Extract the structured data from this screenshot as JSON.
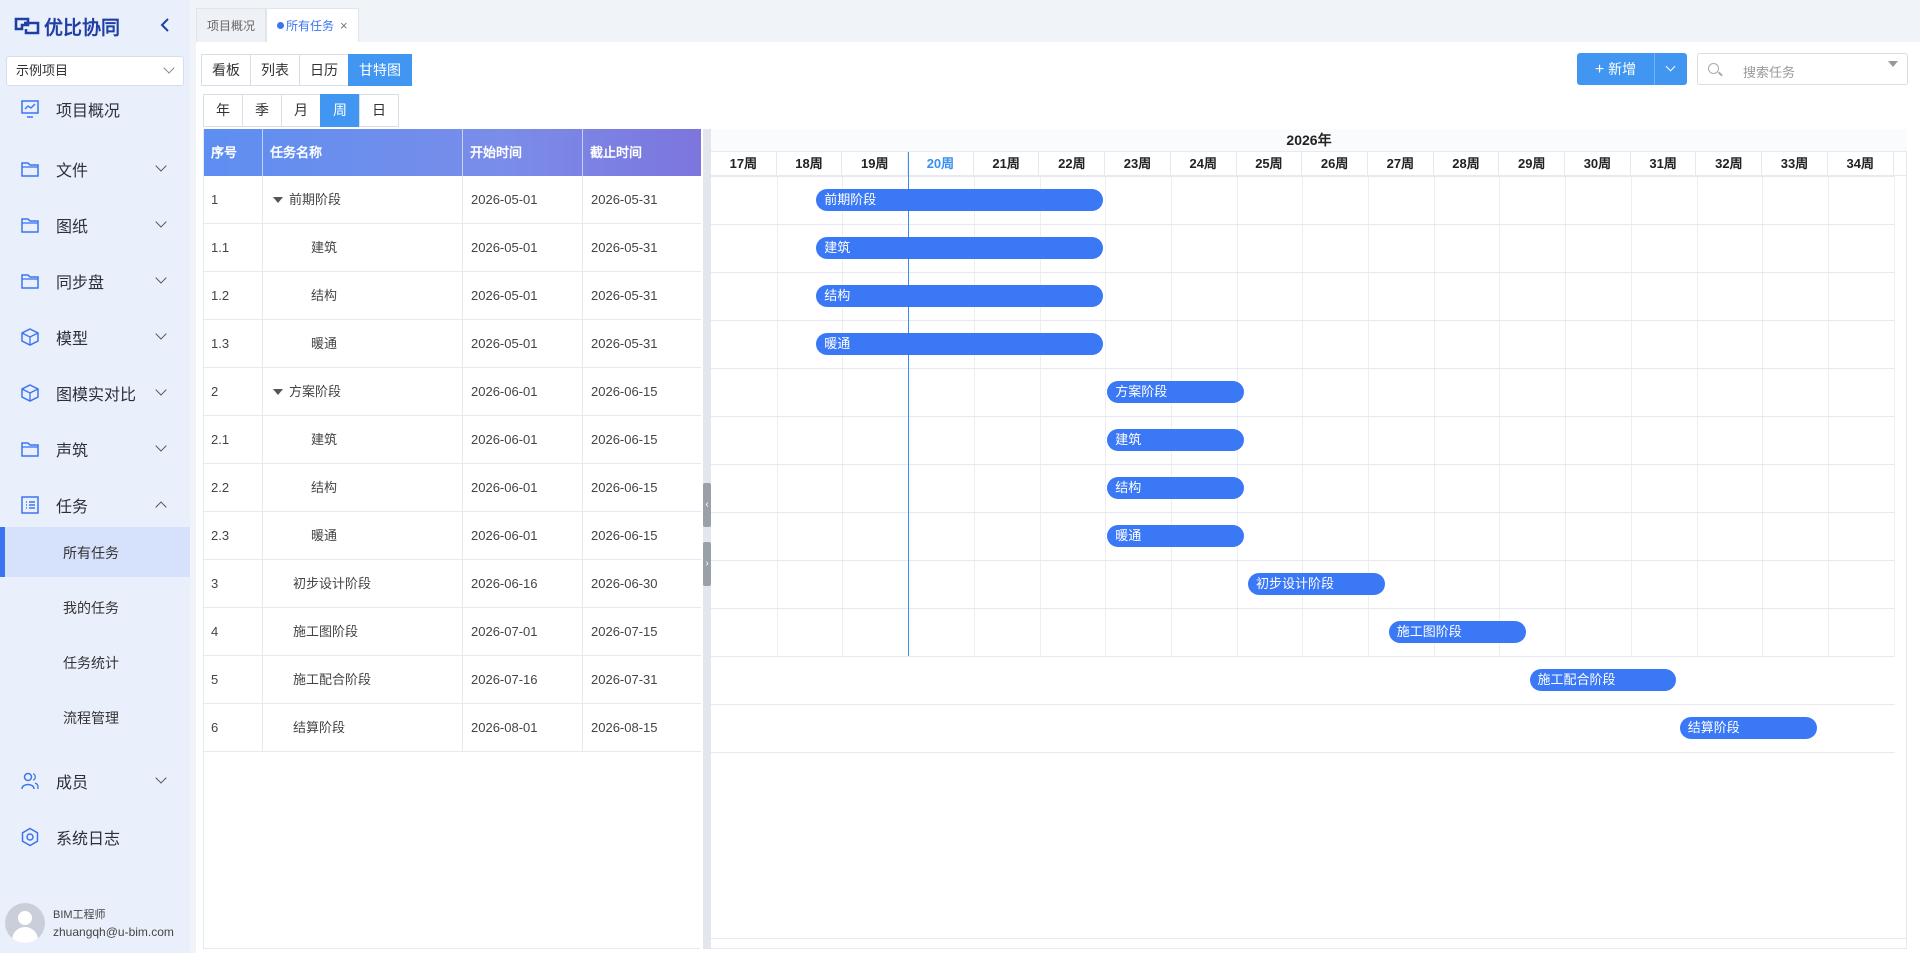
{
  "app": {
    "logo_text": "优比协同",
    "project": "示例项目"
  },
  "sidebar": {
    "items": [
      {
        "label": "项目概况",
        "icon": "monitor-icon",
        "has_chevron": false
      },
      {
        "label": "文件",
        "icon": "folder-icon",
        "has_chevron": true
      },
      {
        "label": "图纸",
        "icon": "folder-icon",
        "has_chevron": true
      },
      {
        "label": "同步盘",
        "icon": "folder-icon",
        "has_chevron": true
      },
      {
        "label": "模型",
        "icon": "cube-icon",
        "has_chevron": true
      },
      {
        "label": "图模实对比",
        "icon": "cube-icon",
        "has_chevron": true
      },
      {
        "label": "声筑",
        "icon": "folder-icon",
        "has_chevron": true
      },
      {
        "label": "任务",
        "icon": "task-list-icon",
        "has_chevron": true,
        "expanded": true
      },
      {
        "label": "成员",
        "icon": "users-icon",
        "has_chevron": true
      },
      {
        "label": "系统日志",
        "icon": "hexagon-gear-icon",
        "has_chevron": false
      }
    ],
    "task_sub": [
      {
        "label": "所有任务",
        "active": true
      },
      {
        "label": "我的任务",
        "active": false
      },
      {
        "label": "任务统计",
        "active": false
      },
      {
        "label": "流程管理",
        "active": false
      }
    ],
    "user": {
      "role": "BIM工程师",
      "email": "zhuangqh@u-bim.com"
    }
  },
  "tabs": [
    {
      "label": "项目概况",
      "active": false
    },
    {
      "label": "所有任务",
      "active": true,
      "close": "×"
    }
  ],
  "toolbar": {
    "views": [
      "看板",
      "列表",
      "日历",
      "甘特图"
    ],
    "active_view": "甘特图",
    "scales": [
      "年",
      "季",
      "月",
      "周",
      "日"
    ],
    "active_scale": "周",
    "add_label": "新增",
    "add_icon": "+",
    "search_placeholder": "搜索任务"
  },
  "grid": {
    "columns": [
      "序号",
      "任务名称",
      "开始时间",
      "截止时间"
    ],
    "rows": [
      {
        "id": "1",
        "name": "前期阶段",
        "start": "2026-05-01",
        "end": "2026-05-31",
        "level": 0,
        "expandable": true
      },
      {
        "id": "1.1",
        "name": "建筑",
        "start": "2026-05-01",
        "end": "2026-05-31",
        "level": 1,
        "expandable": false
      },
      {
        "id": "1.2",
        "name": "结构",
        "start": "2026-05-01",
        "end": "2026-05-31",
        "level": 1,
        "expandable": false
      },
      {
        "id": "1.3",
        "name": "暖通",
        "start": "2026-05-01",
        "end": "2026-05-31",
        "level": 1,
        "expandable": false
      },
      {
        "id": "2",
        "name": "方案阶段",
        "start": "2026-06-01",
        "end": "2026-06-15",
        "level": 0,
        "expandable": true
      },
      {
        "id": "2.1",
        "name": "建筑",
        "start": "2026-06-01",
        "end": "2026-06-15",
        "level": 1,
        "expandable": false
      },
      {
        "id": "2.2",
        "name": "结构",
        "start": "2026-06-01",
        "end": "2026-06-15",
        "level": 1,
        "expandable": false
      },
      {
        "id": "2.3",
        "name": "暖通",
        "start": "2026-06-01",
        "end": "2026-06-15",
        "level": 1,
        "expandable": false
      },
      {
        "id": "3",
        "name": "初步设计阶段",
        "start": "2026-06-16",
        "end": "2026-06-30",
        "level": 0,
        "expandable": false
      },
      {
        "id": "4",
        "name": "施工图阶段",
        "start": "2026-07-01",
        "end": "2026-07-15",
        "level": 0,
        "expandable": false
      },
      {
        "id": "5",
        "name": "施工配合阶段",
        "start": "2026-07-16",
        "end": "2026-07-31",
        "level": 0,
        "expandable": false
      },
      {
        "id": "6",
        "name": "结算阶段",
        "start": "2026-08-01",
        "end": "2026-08-15",
        "level": 0,
        "expandable": false
      }
    ]
  },
  "gantt": {
    "year": "2026年",
    "weeks": [
      "17周",
      "18周",
      "19周",
      "20周",
      "21周",
      "22周",
      "23周",
      "24周",
      "25周",
      "26周",
      "27周",
      "28周",
      "29周",
      "30周",
      "31周",
      "32周",
      "33周",
      "34周"
    ],
    "current_week": "20周",
    "colors": {
      "bar": "#3b78f6",
      "today": "#3b8ff0",
      "accent": "#4096f0"
    }
  }
}
